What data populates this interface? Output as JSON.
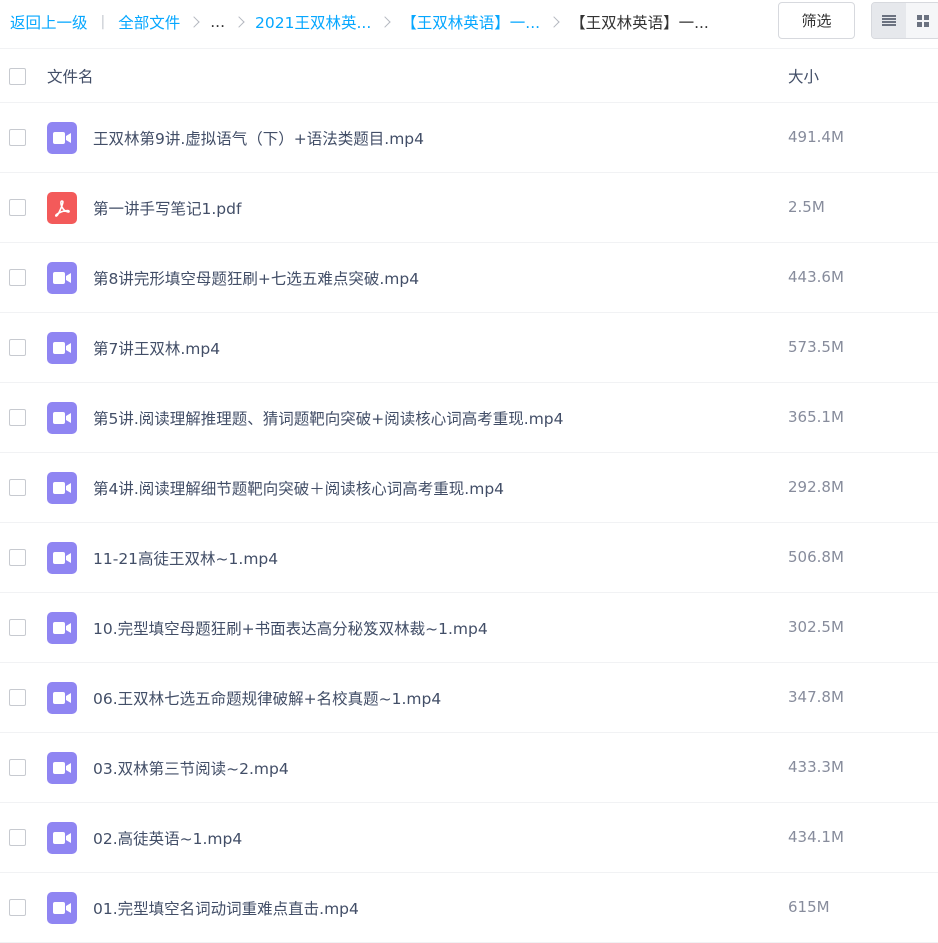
{
  "breadcrumb": {
    "back": "返回上一级",
    "all_files": "全部文件",
    "ellipsis": "...",
    "level1": "2021王双林英...",
    "level2": "【王双林英语】一...",
    "current": "【王双林英语】一..."
  },
  "toolbar": {
    "filter_label": "筛选",
    "view_mode": "list"
  },
  "table": {
    "col_name": "文件名",
    "col_size": "大小"
  },
  "colors": {
    "link": "#06a7ff",
    "video_icon": "#8f85f2",
    "pdf_icon": "#f35a5a"
  },
  "files": [
    {
      "name": "王双林第9讲.虚拟语气（下）+语法类题目.mp4",
      "size": "491.4M",
      "type": "video-icon"
    },
    {
      "name": "第一讲手写笔记1.pdf",
      "size": "2.5M",
      "type": "pdf-icon"
    },
    {
      "name": "第8讲完形填空母题狂刷+七选五难点突破.mp4",
      "size": "443.6M",
      "type": "video-icon"
    },
    {
      "name": "第7讲王双林.mp4",
      "size": "573.5M",
      "type": "video-icon"
    },
    {
      "name": "第5讲.阅读理解推理题、猜词题靶向突破+阅读核心词高考重现.mp4",
      "size": "365.1M",
      "type": "video-icon"
    },
    {
      "name": "第4讲.阅读理解细节题靶向突破＋阅读核心词高考重现.mp4",
      "size": "292.8M",
      "type": "video-icon"
    },
    {
      "name": "11-21高徒王双林~1.mp4",
      "size": "506.8M",
      "type": "video-icon"
    },
    {
      "name": "10.完型填空母题狂刷+书面表达高分秘笈双林裁~1.mp4",
      "size": "302.5M",
      "type": "video-icon"
    },
    {
      "name": "06.王双林七选五命题规律破解+名校真题~1.mp4",
      "size": "347.8M",
      "type": "video-icon"
    },
    {
      "name": "03.双林第三节阅读~2.mp4",
      "size": "433.3M",
      "type": "video-icon"
    },
    {
      "name": "02.高徒英语~1.mp4",
      "size": "434.1M",
      "type": "video-icon"
    },
    {
      "name": "01.完型填空名词动词重难点直击.mp4",
      "size": "615M",
      "type": "video-icon"
    }
  ]
}
